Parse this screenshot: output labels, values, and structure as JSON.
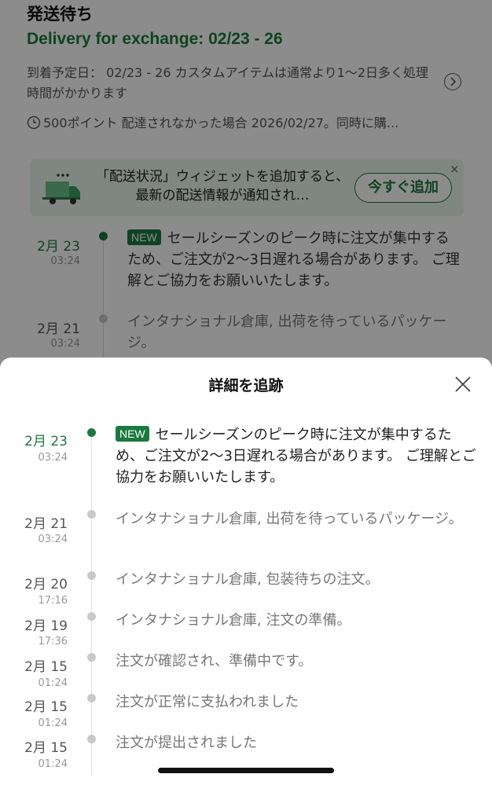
{
  "background": {
    "status_title": "発送待ち",
    "exchange_heading": "Delivery for exchange: 02/23 - 26",
    "eta_text": "到着予定日： 02/23 - 26 カスタムアイテムは通常より1〜2日多く処理時間がかかります",
    "points_text": "500ポイント 配達されなかった場合 2026/02/27。同時に購...",
    "banner": {
      "text": "「配送状況」ウィジェットを追加すると、最新の配送情報が通知され…",
      "button_label": "今すぐ追加",
      "close_glyph": "×"
    },
    "events": [
      {
        "date": "2月 23",
        "time": "03:24",
        "badge": "NEW",
        "text": "セールシーズンのピーク時に注文が集中するため、ご注文が2〜3日遅れる場合があります。 ご理解とご協力をお願いいたします。"
      },
      {
        "date": "2月 21",
        "time": "03:24",
        "text": "インタナショナル倉庫, 出荷を待っているパッケージ。"
      }
    ]
  },
  "sheet": {
    "title": "詳細を追跡",
    "events": [
      {
        "date": "2月 23",
        "time": "03:24",
        "badge": "NEW",
        "text": "セールシーズンのピーク時に注文が集中するため、ご注文が2〜3日遅れる場合があります。 ご理解とご協力をお願いいたします。"
      },
      {
        "date": "2月 21",
        "time": "03:24",
        "text": "インタナショナル倉庫, 出荷を待っているパッケージ。"
      },
      {
        "date": "2月 20",
        "time": "17:16",
        "text": "インタナショナル倉庫, 包装待ちの注文。"
      },
      {
        "date": "2月 19",
        "time": "17:36",
        "text": "インタナショナル倉庫, 注文の準備。"
      },
      {
        "date": "2月 15",
        "time": "01:24",
        "text": "注文が確認され、準備中です。"
      },
      {
        "date": "2月 15",
        "time": "01:24",
        "text": "注文が正常に支払われました"
      },
      {
        "date": "2月 15",
        "time": "01:24",
        "text": "注文が提出されました"
      }
    ]
  },
  "colors": {
    "accent": "#1a7a3e",
    "banner_bg": "#e9f4ec",
    "overlay": "rgba(0,0,0,0.45)"
  },
  "icons": [
    "chevron-right-icon",
    "clock-icon",
    "truck-icon",
    "close-icon"
  ]
}
